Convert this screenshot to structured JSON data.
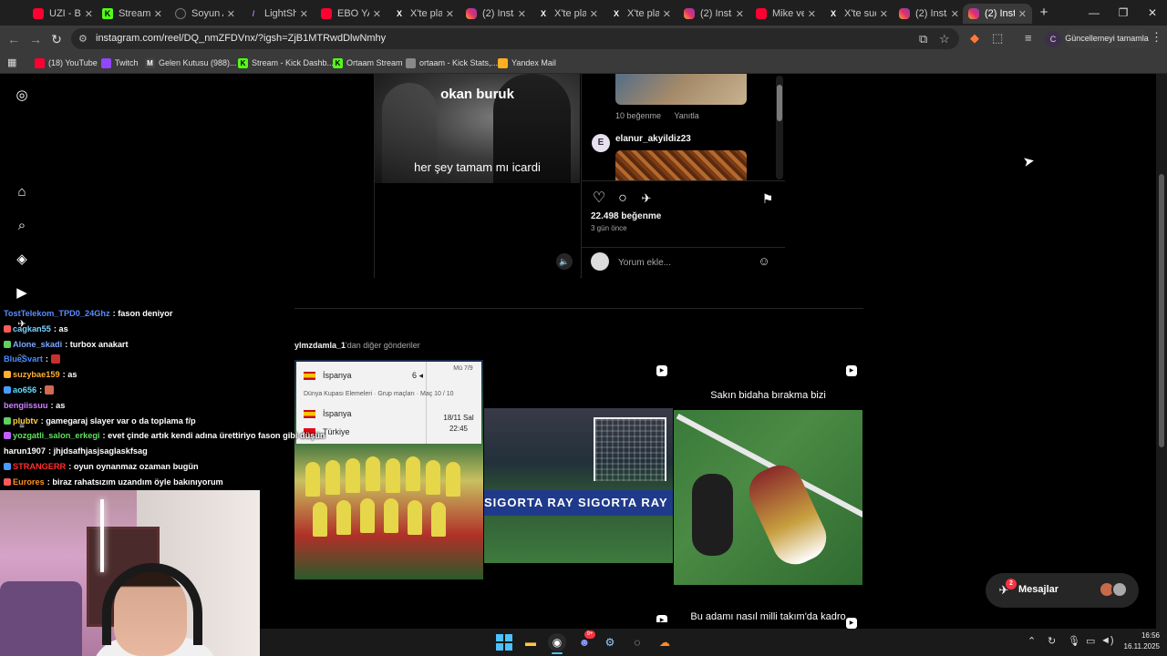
{
  "browser": {
    "tabs": [
      {
        "label": "UZI - BA",
        "favicon": "youtube-icon"
      },
      {
        "label": "Stream -",
        "favicon": "kick-icon"
      },
      {
        "label": "Soyun A",
        "favicon": "soyun-icon"
      },
      {
        "label": "LightSh",
        "favicon": "lightshot-icon"
      },
      {
        "label": "EBO YAL",
        "favicon": "youtube-icon"
      },
      {
        "label": "X'te plat",
        "favicon": "x-icon"
      },
      {
        "label": "(2) Insta",
        "favicon": "instagram-icon"
      },
      {
        "label": "X'te plat",
        "favicon": "x-icon"
      },
      {
        "label": "X'te plat",
        "favicon": "x-icon"
      },
      {
        "label": "(2) Insta",
        "favicon": "instagram-icon"
      },
      {
        "label": "Mike ve",
        "favicon": "youtube-icon"
      },
      {
        "label": "X'te sucl",
        "favicon": "x-icon"
      },
      {
        "label": "(2) Insta",
        "favicon": "instagram-icon"
      },
      {
        "label": "(2) Insta",
        "favicon": "instagram-icon",
        "active": true
      }
    ],
    "url": "instagram.com/reel/DQ_nmZFDVnx/?igsh=ZjB1MTRwdDlwNmhy",
    "profile_initial": "C",
    "update_label": "Güncellemeyi tamamla",
    "bookmarks": [
      "(18) YouTube",
      "Twitch",
      "Gelen Kutusu (988)...",
      "Stream - Kick Dashb...",
      "Ortaam Stream",
      "ortaam - Kick Stats,...",
      "Yandex Mail"
    ]
  },
  "post": {
    "video_caption_top": "okan buruk",
    "video_caption_bottom": "her şey tamam mı icardi",
    "comment_meta": {
      "likes": "10 beğenme",
      "reply": "Yanıtla"
    },
    "comment_user": "elanur_akyildiz23",
    "comment_user_initial": "E",
    "likes_label": "22.498 beğenme",
    "time_label": "3 gün önce",
    "comment_placeholder": "Yorum ekle..."
  },
  "more_posts": {
    "username": "ylmzdamla_1",
    "suffix": "'dan diğer gönderiler",
    "grid": {
      "g1": {
        "team_top": "İspanya",
        "score": "6",
        "date_top": "Mü 7/9",
        "competition": "Dünya Kupası Elemeleri · Grup maçları · Maç 10 / 10",
        "home": "İspanya",
        "away": "Türkiye",
        "date": "18/11 Sal",
        "time": "22:45"
      },
      "g2": {
        "ad_text": "SIGORTA   RAY SIGORTA   RAY"
      },
      "g3": {
        "caption_top": "Sakın bidaha bırakma bizi",
        "caption_bottom": "Bu adamı nasıl milli takım'da kadro"
      }
    }
  },
  "messages": {
    "label": "Mesajlar",
    "badge": "2"
  },
  "chat": [
    {
      "user": "TostTelekom_TPD0_24Ghz",
      "color": "#5b8cff",
      "msg": "fason deniyor"
    },
    {
      "user": "cagkan55",
      "color": "#7ad4ff",
      "msg": "as"
    },
    {
      "user": "Alone_skadi",
      "color": "#7aa8ff",
      "msg": "turbox anakart"
    },
    {
      "user": "BlueSvart",
      "color": "#4a8cff",
      "msg": ""
    },
    {
      "user": "suzybae159",
      "color": "#ffb030",
      "msg": "as"
    },
    {
      "user": "ao656",
      "color": "#5be0ff",
      "msg": ""
    },
    {
      "user": "bengiissuu",
      "color": "#d080ff",
      "msg": "as"
    },
    {
      "user": "plubtv",
      "color": "#ffd040",
      "msg": "gamegaraj slayer var o da toplama f/p"
    },
    {
      "user": "yozgatli_salon_erkegi",
      "color": "#60e060",
      "msg": "evet çinde artık kendi adına ürettiriyo fason gibi düşün"
    },
    {
      "user": "harun1907",
      "color": "#ffffff",
      "msg": "jhjdsafhjasjsaglaskfsag"
    },
    {
      "user": "STRANGERR",
      "color": "#ff3030",
      "msg": "oyun oynanmaz ozaman bugün"
    },
    {
      "user": "Eurores",
      "color": "#ff9020",
      "msg": "biraz rahatsızım uzandım öyle bakınıyorum"
    }
  ],
  "taskbar": {
    "time": "16:56",
    "date": "16.11.2025",
    "discord_badge": "9+"
  },
  "colors": {
    "accent": "#4cc2ff",
    "instagram_red": "#ff3040",
    "kick_green": "#53fc18"
  }
}
